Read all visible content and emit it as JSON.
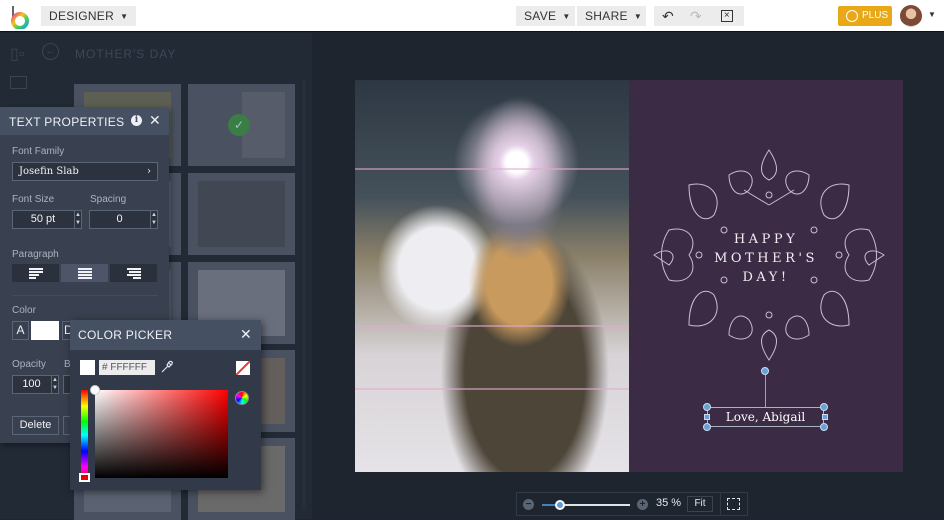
{
  "topbar": {
    "mode_menu": "DESIGNER",
    "save": "SAVE",
    "share": "SHARE",
    "plus": "PLUS",
    "icons": [
      "logo-icon",
      "undo-icon",
      "redo-icon",
      "close-design-icon",
      "plus-badge-icon",
      "user-avatar"
    ]
  },
  "left_panel": {
    "breadcrumb": "MOTHER'S DAY",
    "icons": [
      "layouts-icon",
      "back-arrow-icon",
      "folder-icon"
    ],
    "templates": [
      {
        "name": "template-1"
      },
      {
        "name": "template-2",
        "selected": true
      },
      {
        "name": "template-3"
      },
      {
        "name": "template-4"
      },
      {
        "name": "template-5"
      },
      {
        "name": "template-6"
      },
      {
        "name": "template-7"
      },
      {
        "name": "template-8"
      },
      {
        "name": "template-9"
      },
      {
        "name": "template-10"
      }
    ]
  },
  "text_properties": {
    "title": "TEXT PROPERTIES",
    "font_family_label": "Font Family",
    "font_family_value": "Josefin Slab",
    "font_size_label": "Font Size",
    "font_size_value": "50 pt",
    "spacing_label": "Spacing",
    "spacing_value": "0",
    "paragraph_label": "Paragraph",
    "alignment_options": [
      "left",
      "center",
      "right"
    ],
    "alignment_selected": "center",
    "color_label": "Color",
    "color_a": "A",
    "color_d": "D",
    "color_value": "#FFFFFF",
    "opacity_label": "Opacity",
    "opacity_value": "100",
    "blend_label": "B",
    "delete_label": "Delete"
  },
  "color_picker": {
    "title": "COLOR PICKER",
    "hex_value": "# FFFFFF",
    "hue": "red"
  },
  "card": {
    "headline_line1": "HAPPY",
    "headline_line2": "MOTHER'S",
    "headline_line3": "DAY!",
    "selected_text": "Love, Abigail",
    "background_color": "#3b2b45"
  },
  "zoom": {
    "level": "35 %",
    "level_fraction": 0.2,
    "fit_label": "Fit"
  }
}
